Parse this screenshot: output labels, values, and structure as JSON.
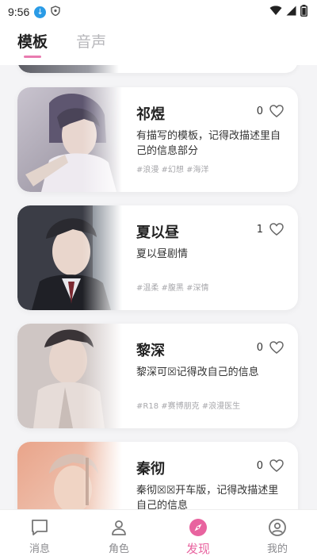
{
  "status": {
    "time": "9:56"
  },
  "tabs": [
    {
      "label": "模板",
      "active": true
    },
    {
      "label": "音声",
      "active": false
    }
  ],
  "cards": [
    {
      "name": "祁煜",
      "likes": "0",
      "desc": "有描写的模板，记得改描述里自己的信息部分",
      "tags": "#浪漫 #幻想 #海洋"
    },
    {
      "name": "夏以昼",
      "likes": "1",
      "desc": "夏以昼剧情",
      "tags": "#温柔 #腹黑 #深情"
    },
    {
      "name": "黎深",
      "likes": "0",
      "desc": "黎深可☒记得改自己的信息",
      "tags": "#R18 #赛博朋克 #浪漫医生"
    },
    {
      "name": "秦彻",
      "likes": "0",
      "desc": "秦彻☒☒开车版，记得改描述里自己的信息",
      "tags": ""
    }
  ],
  "nav": [
    {
      "label": "消息",
      "icon": "message-icon"
    },
    {
      "label": "角色",
      "icon": "person-icon"
    },
    {
      "label": "发现",
      "icon": "compass-icon",
      "active": true
    },
    {
      "label": "我的",
      "icon": "profile-icon"
    }
  ],
  "colors": {
    "accent": "#e8639f",
    "tab_underline": "#e97bb0",
    "background": "#f4f4f6"
  }
}
